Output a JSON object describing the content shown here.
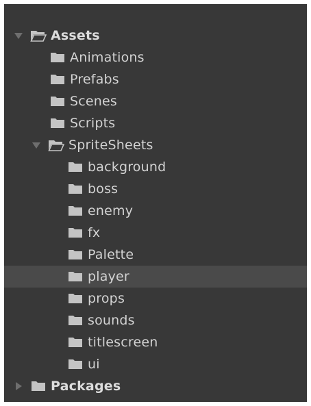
{
  "tree": {
    "assets": {
      "label": "Assets",
      "expanded": true,
      "children": {
        "animations": "Animations",
        "prefabs": "Prefabs",
        "scenes": "Scenes",
        "scripts": "Scripts",
        "spritesheets": {
          "label": "SpriteSheets",
          "expanded": true,
          "children": {
            "background": "background",
            "boss": "boss",
            "enemy": "enemy",
            "fx": "fx",
            "palette": "Palette",
            "player": "player",
            "props": "props",
            "sounds": "sounds",
            "titlescreen": "titlescreen",
            "ui": "ui"
          }
        }
      }
    },
    "packages": {
      "label": "Packages",
      "expanded": false
    },
    "selected_item": "player"
  },
  "colors": {
    "panel_background": "#383838",
    "selected_row": "#4a4a4a",
    "text": "#d2d2d2",
    "icon": "#c4c4c4",
    "arrow": "#6e6e6e"
  }
}
